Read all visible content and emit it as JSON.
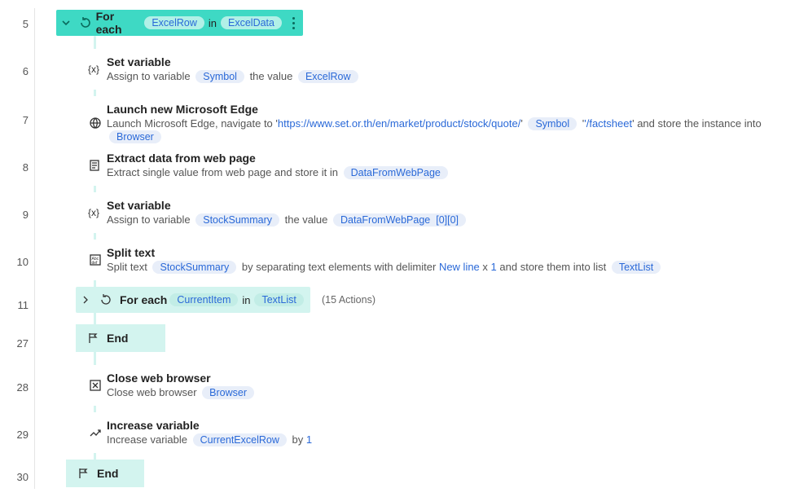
{
  "lines": {
    "l5": "5",
    "l6": "6",
    "l7": "7",
    "l8": "8",
    "l9": "9",
    "l10": "10",
    "l11": "11",
    "l27": "27",
    "l28": "28",
    "l29": "29",
    "l30": "30"
  },
  "foreach1": {
    "label": "For each",
    "item": "ExcelRow",
    "in": "in",
    "collection": "ExcelData"
  },
  "a_setvar1": {
    "title": "Set variable",
    "pre": "Assign to variable",
    "var": "Symbol",
    "mid": "the value",
    "val": "ExcelRow"
  },
  "a_edge": {
    "title": "Launch new Microsoft Edge",
    "pre": "Launch Microsoft Edge, navigate to '",
    "url": "https://www.set.or.th/en/market/product/stock/quote/",
    "mark": "'",
    "var": "Symbol",
    "post1": "'/factsheet",
    "post2": "' and store the instance into",
    "store": "Browser"
  },
  "a_extract": {
    "title": "Extract data from web page",
    "pre": "Extract single value from web page and store it in",
    "var": "DataFromWebPage"
  },
  "a_setvar2": {
    "title": "Set variable",
    "pre": "Assign to variable",
    "var": "StockSummary",
    "mid": "the value",
    "val": "DataFromWebPage",
    "idx": "[0][0]"
  },
  "a_split": {
    "title": "Split text",
    "pre": "Split text",
    "var": "StockSummary",
    "mid": "by separating text elements with delimiter",
    "d1": "New line",
    "x": "x",
    "n": "1",
    "post": "and store them into list",
    "store": "TextList"
  },
  "foreach2": {
    "label": "For each",
    "item": "CurrentItem",
    "in": "in",
    "collection": "TextList",
    "count": "(15 Actions)"
  },
  "end1": {
    "label": "End"
  },
  "a_close": {
    "title": "Close web browser",
    "pre": "Close web browser",
    "var": "Browser"
  },
  "a_incr": {
    "title": "Increase variable",
    "pre": "Increase variable",
    "var": "CurrentExcelRow",
    "mid": "by",
    "n": "1"
  },
  "end2": {
    "label": "End"
  }
}
